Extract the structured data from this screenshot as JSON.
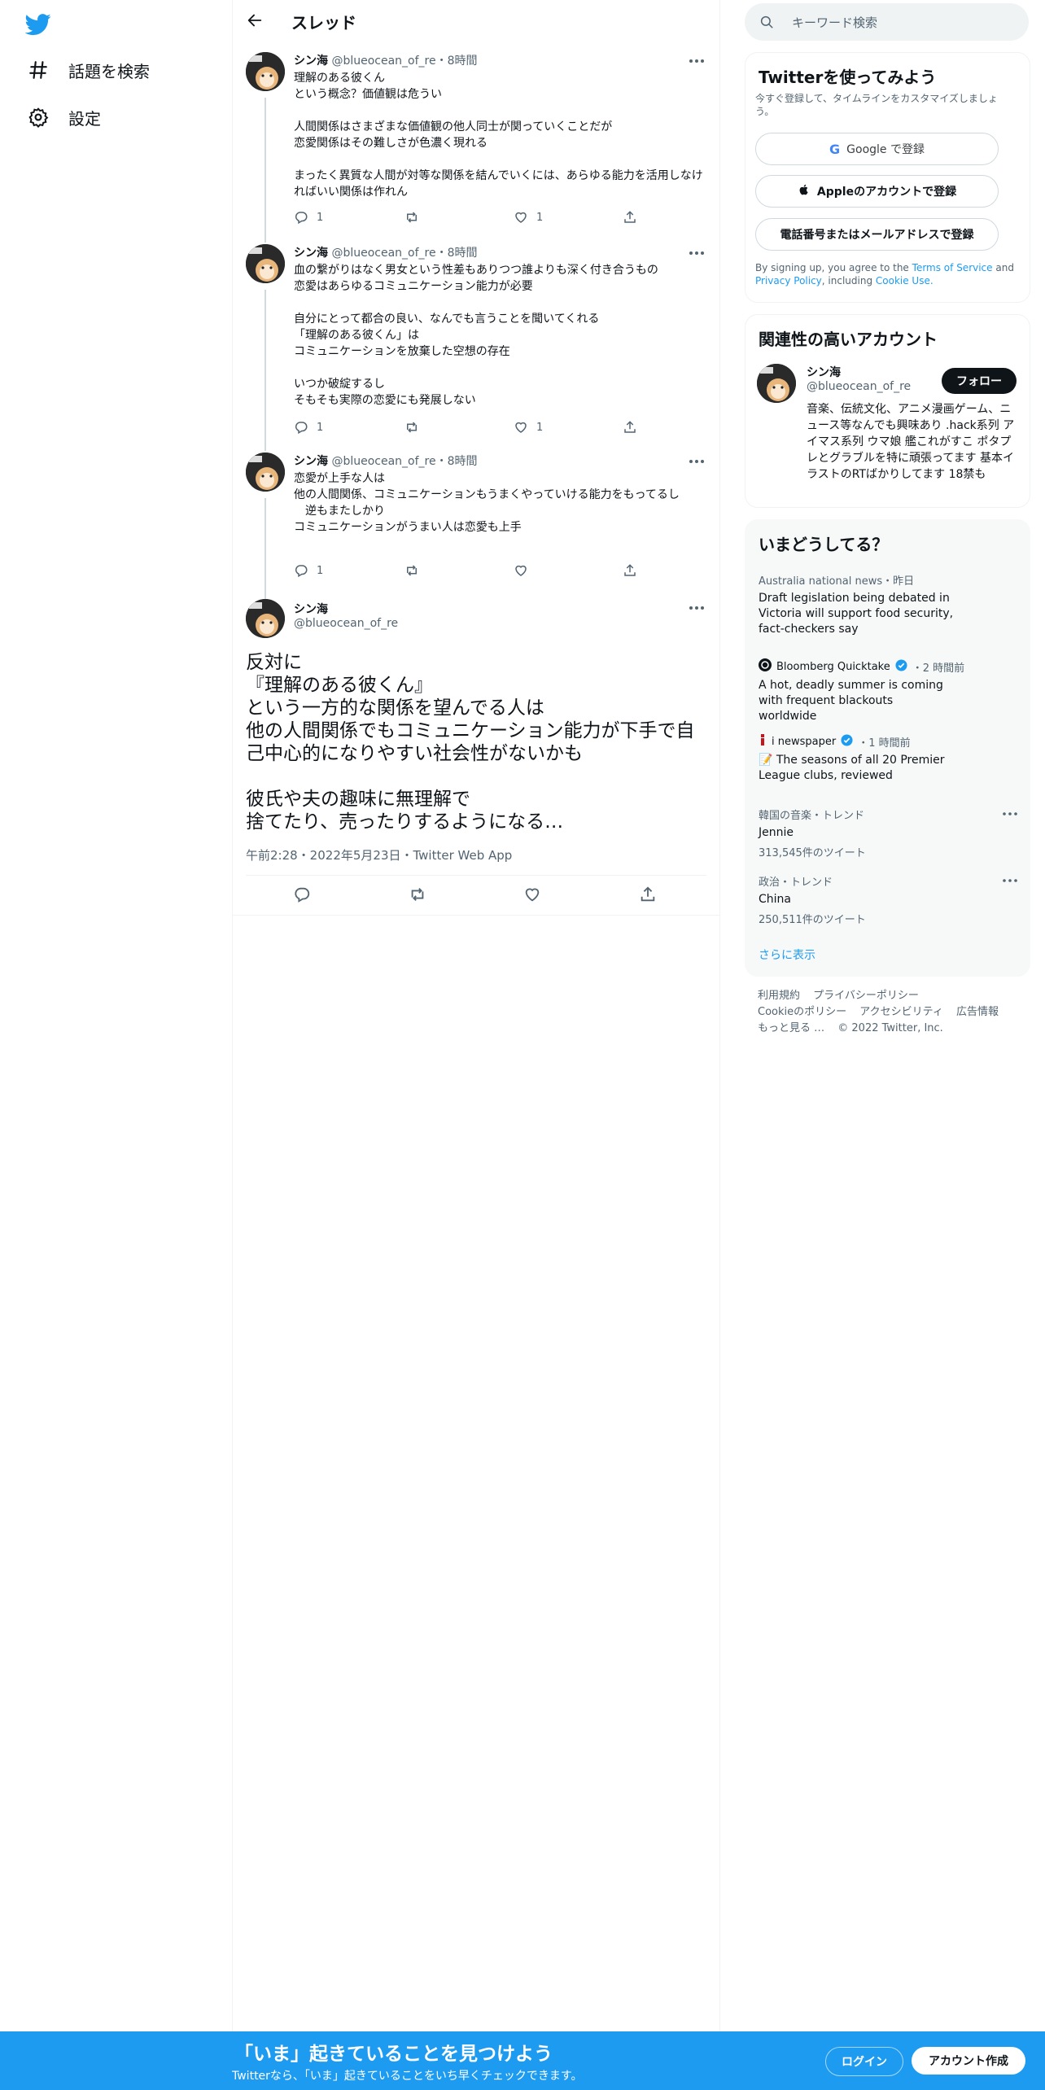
{
  "colors": {
    "accent": "#1d9bf0",
    "text": "#0f1419",
    "muted": "#536471",
    "follow_button": "#0f1419"
  },
  "nav": {
    "logo_icon": "twitter-bird-icon",
    "items": [
      {
        "label": "話題を検索",
        "icon": "hashtag-icon"
      },
      {
        "label": "設定",
        "icon": "gear-icon"
      }
    ]
  },
  "header": {
    "title": "スレッド",
    "back_icon": "arrow-left-icon"
  },
  "tweets": [
    {
      "name": "シン海",
      "handle": "@blueocean_of_re",
      "time": "8時間",
      "text": "理解のある彼くん\nという概念？価値観は危うい\n\n人間関係はさまざまな価値観の他人同士が関っていくことだが\n恋愛関係はその難しさが色濃く現れる\n\nまったく異質な人間が対等な関係を結んでいくには、あらゆる能力を活用しなければいい関係は作れん",
      "replies": "1",
      "retweets": "",
      "likes": "1"
    },
    {
      "name": "シン海",
      "handle": "@blueocean_of_re",
      "time": "8時間",
      "text": "血の繋がりはなく男女という性差もありつつ誰よりも深く付き合うもの\n恋愛はあらゆるコミュニケーション能力が必要\n\n自分にとって都合の良い、なんでも言うことを聞いてくれる\n「理解のある彼くん」は\nコミュニケーションを放棄した空想の存在\n\nいつか破綻するし\nそもそも実際の恋愛にも発展しない",
      "replies": "1",
      "retweets": "",
      "likes": "1"
    },
    {
      "name": "シン海",
      "handle": "@blueocean_of_re",
      "time": "8時間",
      "text": "恋愛が上手な人は\n他の人間関係、コミュニケーションもうまくやっていける能力をもってるし\n　逆もまたしかり\nコミュニケーションがうまい人は恋愛も上手",
      "replies": "1",
      "retweets": "",
      "likes": ""
    }
  ],
  "main_tweet": {
    "name": "シン海",
    "handle": "@blueocean_of_re",
    "text": "反対に\n『理解のある彼くん』\nという一方的な関係を望んでる人は\n他の人間関係でもコミュニケーション能力が下手で自己中心的になりやすい社会性がないかも\n\n彼氏や夫の趣味に無理解で\n捨てたり、売ったりするようになる…",
    "timestamp": "午前2:28・2022年5月23日・Twitter Web App"
  },
  "search": {
    "placeholder": "キーワード検索"
  },
  "signup_card": {
    "title": "Twitterを使ってみよう",
    "subtitle": "今すぐ登録して、タイムラインをカスタマイズしましょう。",
    "google_label": "Google で登録",
    "apple_label": "Appleのアカウントで登録",
    "phone_label": "電話番号またはメールアドレスで登録",
    "terms_prefix": "By signing up, you agree to the",
    "terms_link": "Terms of Service",
    "and": "and",
    "privacy_link": "Privacy Policy",
    "including": ", including",
    "cookie_link": "Cookie Use."
  },
  "related": {
    "title": "関連性の高いアカウント",
    "name": "シン海",
    "handle": "@blueocean_of_re",
    "follow_label": "フォロー",
    "bio": "音楽、伝統文化、アニメ漫画ゲーム、ニュース等なんでも興味あり .hack系列 アイマス系列 ウマ娘 艦これがすこ ポタプレとグラブルを特に頑張ってます 基本イラストのRTばかりしてます 18禁も"
  },
  "trends": {
    "title": "いまどうしてる？",
    "items": [
      {
        "context": "Australia national news・昨日",
        "title": "Draft legislation being debated in Victoria will support food security, fact-checkers say",
        "count": ""
      },
      {
        "context": "Bloomberg Quicktake",
        "context_time": "・2 時間前",
        "title": "A hot, deadly summer is coming with frequent blackouts worldwide",
        "count": ""
      },
      {
        "context": "i newspaper",
        "context_time": "・1 時間前",
        "title": "📝 The seasons of all 20 Premier League clubs, reviewed",
        "count": ""
      },
      {
        "context": "韓国の音楽・トレンド",
        "title": "Jennie",
        "count": "313,545件のツイート"
      },
      {
        "context": "政治・トレンド",
        "title": "China",
        "count": "250,511件のツイート"
      }
    ],
    "show_more": "さらに表示"
  },
  "footer": {
    "links": [
      "利用規約",
      "プライバシーポリシー",
      "Cookieのポリシー",
      "アクセシビリティ",
      "広告情報",
      "もっと見る …"
    ],
    "copyright": "© 2022 Twitter, Inc."
  },
  "banner": {
    "title": "「いま」起きていることを見つけよう",
    "subtitle": "Twitterなら、「いま」起きていることをいち早くチェックできます。",
    "login_label": "ログイン",
    "signup_label": "アカウント作成"
  }
}
